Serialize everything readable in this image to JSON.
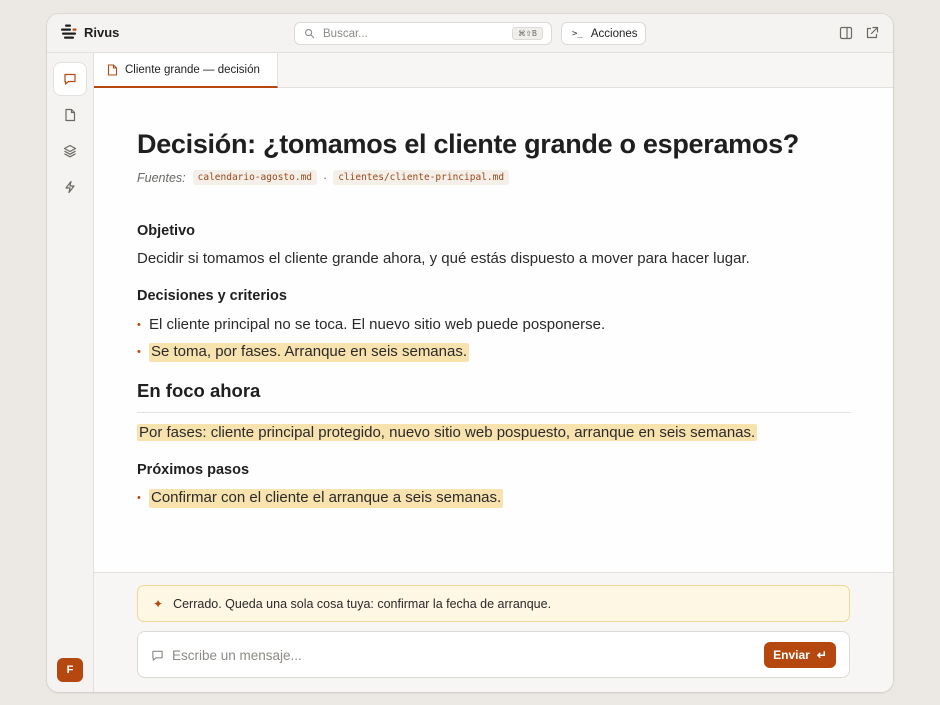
{
  "app": {
    "name": "Rivus"
  },
  "search": {
    "placeholder": "Buscar...",
    "shortcut": "⌘⇧B"
  },
  "toolbar": {
    "actions_prompt": ">_",
    "actions_label": "Acciones"
  },
  "tab": {
    "label": "Cliente grande — decisión"
  },
  "sidebar": {
    "items": [
      {
        "name": "chat",
        "icon": "chat-icon",
        "active": true
      },
      {
        "name": "document",
        "icon": "document-icon",
        "active": false
      },
      {
        "name": "layers",
        "icon": "layers-icon",
        "active": false
      },
      {
        "name": "bolt",
        "icon": "bolt-icon",
        "active": false
      }
    ],
    "avatar": "F"
  },
  "document": {
    "title": "Decisión: ¿tomamos el cliente grande o esperamos?",
    "sources_label": "Fuentes:",
    "sources": [
      "calendario-agosto.md",
      "clientes/cliente-principal.md"
    ],
    "sources_separator": "·",
    "objective_heading": "Objetivo",
    "objective_text": "Decidir si tomamos el cliente grande ahora, y qué estás dispuesto a mover para hacer lugar.",
    "criteria_heading": "Decisiones y criterios",
    "criteria": [
      "El cliente principal no se toca. El nuevo sitio web puede posponerse.",
      "Se toma, por fases. Arranque en seis semanas."
    ],
    "focus_heading": "En foco ahora",
    "focus_text": "Por fases: cliente principal protegido, nuevo sitio web pospuesto, arranque en seis semanas.",
    "next_heading": "Próximos pasos",
    "next_steps": [
      "Confirmar con el cliente el arranque a seis semanas."
    ]
  },
  "notice": {
    "icon": "sparkle-icon",
    "text": "Cerrado. Queda una sola cosa tuya: confirmar la fecha de arranque."
  },
  "composer": {
    "placeholder": "Escribe un mensaje...",
    "value": "",
    "send_label": "Enviar",
    "send_icon": "↵"
  },
  "colors": {
    "accent": "#b5480f",
    "highlight": "#f8e2ae",
    "notice_bg": "#fdf7e4"
  }
}
